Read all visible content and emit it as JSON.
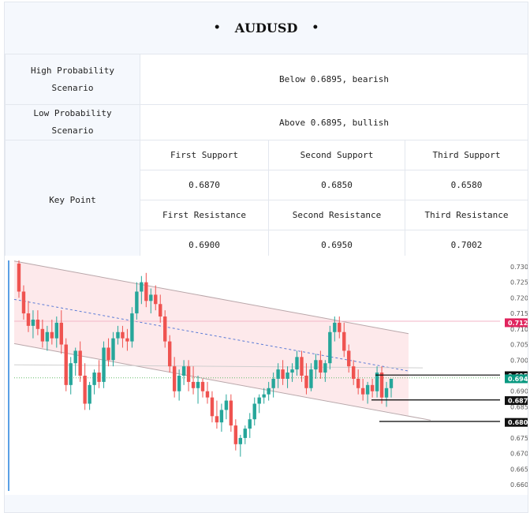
{
  "header": {
    "title": "AUDUSD",
    "bullet": "•"
  },
  "scenarios": {
    "high": {
      "label": "High Probability Scenario",
      "value": "Below 0.6895, bearish"
    },
    "low": {
      "label": "Low Probability Scenario",
      "value": "Above 0.6895, bullish"
    }
  },
  "key_point": {
    "label": "Key Point",
    "support": [
      {
        "label": "First Support",
        "value": "0.6870"
      },
      {
        "label": "Second Support",
        "value": "0.6850"
      },
      {
        "label": "Third Support",
        "value": "0.6580"
      }
    ],
    "resistance": [
      {
        "label": "First Resistance",
        "value": "0.6900"
      },
      {
        "label": "Second Resistance",
        "value": "0.6950"
      },
      {
        "label": "Third Resistance",
        "value": "0.7002"
      }
    ]
  },
  "chart": {
    "yticks": [
      "0.730",
      "0.725",
      "0.720",
      "0.715",
      "0.710",
      "0.705",
      "0.700",
      "0.695",
      "0.690",
      "0.685",
      "0.680",
      "0.675",
      "0.670",
      "0.665",
      "0.660"
    ],
    "price_tags": [
      {
        "text": "0.712",
        "color": "#e0245e"
      },
      {
        "text": "0.695",
        "color": "#111111"
      },
      {
        "text": "0.694",
        "color": "#089981"
      },
      {
        "text": "0.687",
        "color": "#111111"
      },
      {
        "text": "0.680",
        "color": "#111111"
      }
    ],
    "colors": {
      "up": "#26a69a",
      "down": "#ef5350",
      "channel_fill": "#fde4e6",
      "channel_line": "#b9a7aa"
    }
  },
  "chart_data": {
    "type": "candlestick",
    "ylim": [
      0.658,
      0.732
    ],
    "candles": [
      [
        0.731,
        0.732,
        0.72,
        0.722
      ],
      [
        0.722,
        0.724,
        0.713,
        0.715
      ],
      [
        0.715,
        0.719,
        0.709,
        0.711
      ],
      [
        0.711,
        0.716,
        0.707,
        0.713
      ],
      [
        0.713,
        0.716,
        0.708,
        0.71
      ],
      [
        0.71,
        0.713,
        0.704,
        0.706
      ],
      [
        0.706,
        0.711,
        0.703,
        0.709
      ],
      [
        0.709,
        0.713,
        0.705,
        0.707
      ],
      [
        0.707,
        0.714,
        0.704,
        0.712
      ],
      [
        0.712,
        0.716,
        0.702,
        0.705
      ],
      [
        0.705,
        0.707,
        0.69,
        0.692
      ],
      [
        0.692,
        0.701,
        0.689,
        0.699
      ],
      [
        0.699,
        0.704,
        0.695,
        0.703
      ],
      [
        0.703,
        0.706,
        0.693,
        0.695
      ],
      [
        0.695,
        0.699,
        0.684,
        0.686
      ],
      [
        0.686,
        0.693,
        0.684,
        0.692
      ],
      [
        0.692,
        0.697,
        0.689,
        0.696
      ],
      [
        0.696,
        0.7,
        0.691,
        0.693
      ],
      [
        0.693,
        0.706,
        0.691,
        0.704
      ],
      [
        0.704,
        0.707,
        0.698,
        0.7
      ],
      [
        0.7,
        0.709,
        0.698,
        0.707
      ],
      [
        0.707,
        0.711,
        0.705,
        0.709
      ],
      [
        0.709,
        0.711,
        0.704,
        0.707
      ],
      [
        0.707,
        0.71,
        0.703,
        0.706
      ],
      [
        0.706,
        0.717,
        0.704,
        0.715
      ],
      [
        0.715,
        0.725,
        0.713,
        0.722
      ],
      [
        0.722,
        0.727,
        0.718,
        0.725
      ],
      [
        0.725,
        0.728,
        0.717,
        0.719
      ],
      [
        0.719,
        0.723,
        0.715,
        0.721
      ],
      [
        0.721,
        0.724,
        0.716,
        0.718
      ],
      [
        0.718,
        0.721,
        0.712,
        0.714
      ],
      [
        0.714,
        0.716,
        0.704,
        0.706
      ],
      [
        0.706,
        0.708,
        0.696,
        0.698
      ],
      [
        0.698,
        0.701,
        0.688,
        0.69
      ],
      [
        0.69,
        0.697,
        0.687,
        0.695
      ],
      [
        0.695,
        0.7,
        0.692,
        0.698
      ],
      [
        0.698,
        0.7,
        0.69,
        0.693
      ],
      [
        0.693,
        0.698,
        0.689,
        0.691
      ],
      [
        0.691,
        0.695,
        0.686,
        0.693
      ],
      [
        0.693,
        0.694,
        0.688,
        0.69
      ],
      [
        0.69,
        0.693,
        0.686,
        0.688
      ],
      [
        0.688,
        0.69,
        0.68,
        0.682
      ],
      [
        0.682,
        0.687,
        0.678,
        0.68
      ],
      [
        0.68,
        0.686,
        0.677,
        0.684
      ],
      [
        0.684,
        0.689,
        0.681,
        0.687
      ],
      [
        0.687,
        0.689,
        0.677,
        0.679
      ],
      [
        0.679,
        0.681,
        0.671,
        0.673
      ],
      [
        0.673,
        0.676,
        0.669,
        0.675
      ],
      [
        0.675,
        0.679,
        0.673,
        0.678
      ],
      [
        0.678,
        0.683,
        0.675,
        0.681
      ],
      [
        0.681,
        0.688,
        0.679,
        0.686
      ],
      [
        0.686,
        0.689,
        0.683,
        0.688
      ],
      [
        0.688,
        0.691,
        0.686,
        0.689
      ],
      [
        0.689,
        0.693,
        0.687,
        0.691
      ],
      [
        0.691,
        0.696,
        0.688,
        0.694
      ],
      [
        0.694,
        0.699,
        0.691,
        0.697
      ],
      [
        0.697,
        0.7,
        0.692,
        0.694
      ],
      [
        0.694,
        0.698,
        0.691,
        0.696
      ],
      [
        0.696,
        0.699,
        0.693,
        0.697
      ],
      [
        0.697,
        0.703,
        0.695,
        0.701
      ],
      [
        0.701,
        0.703,
        0.693,
        0.695
      ],
      [
        0.695,
        0.699,
        0.689,
        0.691
      ],
      [
        0.691,
        0.699,
        0.69,
        0.697
      ],
      [
        0.697,
        0.702,
        0.694,
        0.7
      ],
      [
        0.7,
        0.703,
        0.694,
        0.696
      ],
      [
        0.696,
        0.7,
        0.693,
        0.699
      ],
      [
        0.699,
        0.711,
        0.697,
        0.709
      ],
      [
        0.709,
        0.714,
        0.706,
        0.712
      ],
      [
        0.712,
        0.714,
        0.707,
        0.709
      ],
      [
        0.709,
        0.712,
        0.701,
        0.703
      ],
      [
        0.703,
        0.705,
        0.696,
        0.698
      ],
      [
        0.698,
        0.7,
        0.692,
        0.694
      ],
      [
        0.694,
        0.697,
        0.689,
        0.691
      ],
      [
        0.691,
        0.694,
        0.687,
        0.689
      ],
      [
        0.689,
        0.693,
        0.686,
        0.692
      ],
      [
        0.692,
        0.694,
        0.688,
        0.69
      ],
      [
        0.69,
        0.698,
        0.688,
        0.696
      ],
      [
        0.696,
        0.698,
        0.686,
        0.688
      ],
      [
        0.688,
        0.693,
        0.685,
        0.691
      ],
      [
        0.691,
        0.694,
        0.688,
        0.694
      ]
    ]
  }
}
